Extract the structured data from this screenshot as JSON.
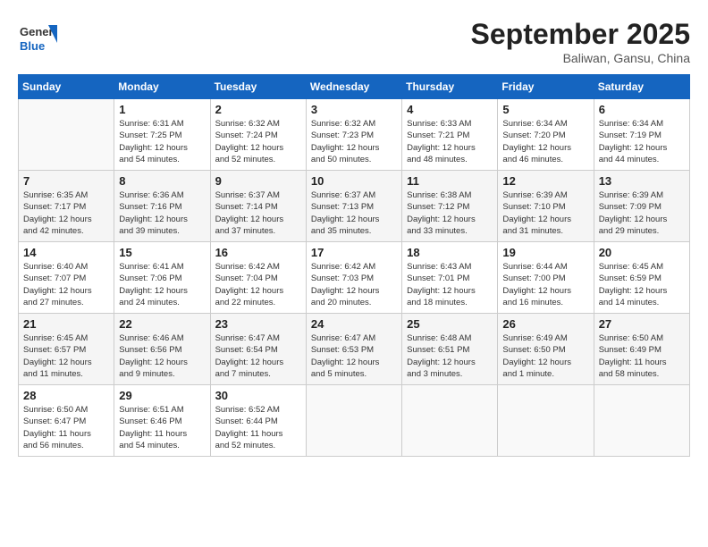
{
  "header": {
    "logo_general": "General",
    "logo_blue": "Blue",
    "month_title": "September 2025",
    "subtitle": "Baliwan, Gansu, China"
  },
  "days_of_week": [
    "Sunday",
    "Monday",
    "Tuesday",
    "Wednesday",
    "Thursday",
    "Friday",
    "Saturday"
  ],
  "weeks": [
    [
      {
        "day": "",
        "info": ""
      },
      {
        "day": "1",
        "info": "Sunrise: 6:31 AM\nSunset: 7:25 PM\nDaylight: 12 hours\nand 54 minutes."
      },
      {
        "day": "2",
        "info": "Sunrise: 6:32 AM\nSunset: 7:24 PM\nDaylight: 12 hours\nand 52 minutes."
      },
      {
        "day": "3",
        "info": "Sunrise: 6:32 AM\nSunset: 7:23 PM\nDaylight: 12 hours\nand 50 minutes."
      },
      {
        "day": "4",
        "info": "Sunrise: 6:33 AM\nSunset: 7:21 PM\nDaylight: 12 hours\nand 48 minutes."
      },
      {
        "day": "5",
        "info": "Sunrise: 6:34 AM\nSunset: 7:20 PM\nDaylight: 12 hours\nand 46 minutes."
      },
      {
        "day": "6",
        "info": "Sunrise: 6:34 AM\nSunset: 7:19 PM\nDaylight: 12 hours\nand 44 minutes."
      }
    ],
    [
      {
        "day": "7",
        "info": "Sunrise: 6:35 AM\nSunset: 7:17 PM\nDaylight: 12 hours\nand 42 minutes."
      },
      {
        "day": "8",
        "info": "Sunrise: 6:36 AM\nSunset: 7:16 PM\nDaylight: 12 hours\nand 39 minutes."
      },
      {
        "day": "9",
        "info": "Sunrise: 6:37 AM\nSunset: 7:14 PM\nDaylight: 12 hours\nand 37 minutes."
      },
      {
        "day": "10",
        "info": "Sunrise: 6:37 AM\nSunset: 7:13 PM\nDaylight: 12 hours\nand 35 minutes."
      },
      {
        "day": "11",
        "info": "Sunrise: 6:38 AM\nSunset: 7:12 PM\nDaylight: 12 hours\nand 33 minutes."
      },
      {
        "day": "12",
        "info": "Sunrise: 6:39 AM\nSunset: 7:10 PM\nDaylight: 12 hours\nand 31 minutes."
      },
      {
        "day": "13",
        "info": "Sunrise: 6:39 AM\nSunset: 7:09 PM\nDaylight: 12 hours\nand 29 minutes."
      }
    ],
    [
      {
        "day": "14",
        "info": "Sunrise: 6:40 AM\nSunset: 7:07 PM\nDaylight: 12 hours\nand 27 minutes."
      },
      {
        "day": "15",
        "info": "Sunrise: 6:41 AM\nSunset: 7:06 PM\nDaylight: 12 hours\nand 24 minutes."
      },
      {
        "day": "16",
        "info": "Sunrise: 6:42 AM\nSunset: 7:04 PM\nDaylight: 12 hours\nand 22 minutes."
      },
      {
        "day": "17",
        "info": "Sunrise: 6:42 AM\nSunset: 7:03 PM\nDaylight: 12 hours\nand 20 minutes."
      },
      {
        "day": "18",
        "info": "Sunrise: 6:43 AM\nSunset: 7:01 PM\nDaylight: 12 hours\nand 18 minutes."
      },
      {
        "day": "19",
        "info": "Sunrise: 6:44 AM\nSunset: 7:00 PM\nDaylight: 12 hours\nand 16 minutes."
      },
      {
        "day": "20",
        "info": "Sunrise: 6:45 AM\nSunset: 6:59 PM\nDaylight: 12 hours\nand 14 minutes."
      }
    ],
    [
      {
        "day": "21",
        "info": "Sunrise: 6:45 AM\nSunset: 6:57 PM\nDaylight: 12 hours\nand 11 minutes."
      },
      {
        "day": "22",
        "info": "Sunrise: 6:46 AM\nSunset: 6:56 PM\nDaylight: 12 hours\nand 9 minutes."
      },
      {
        "day": "23",
        "info": "Sunrise: 6:47 AM\nSunset: 6:54 PM\nDaylight: 12 hours\nand 7 minutes."
      },
      {
        "day": "24",
        "info": "Sunrise: 6:47 AM\nSunset: 6:53 PM\nDaylight: 12 hours\nand 5 minutes."
      },
      {
        "day": "25",
        "info": "Sunrise: 6:48 AM\nSunset: 6:51 PM\nDaylight: 12 hours\nand 3 minutes."
      },
      {
        "day": "26",
        "info": "Sunrise: 6:49 AM\nSunset: 6:50 PM\nDaylight: 12 hours\nand 1 minute."
      },
      {
        "day": "27",
        "info": "Sunrise: 6:50 AM\nSunset: 6:49 PM\nDaylight: 11 hours\nand 58 minutes."
      }
    ],
    [
      {
        "day": "28",
        "info": "Sunrise: 6:50 AM\nSunset: 6:47 PM\nDaylight: 11 hours\nand 56 minutes."
      },
      {
        "day": "29",
        "info": "Sunrise: 6:51 AM\nSunset: 6:46 PM\nDaylight: 11 hours\nand 54 minutes."
      },
      {
        "day": "30",
        "info": "Sunrise: 6:52 AM\nSunset: 6:44 PM\nDaylight: 11 hours\nand 52 minutes."
      },
      {
        "day": "",
        "info": ""
      },
      {
        "day": "",
        "info": ""
      },
      {
        "day": "",
        "info": ""
      },
      {
        "day": "",
        "info": ""
      }
    ]
  ]
}
